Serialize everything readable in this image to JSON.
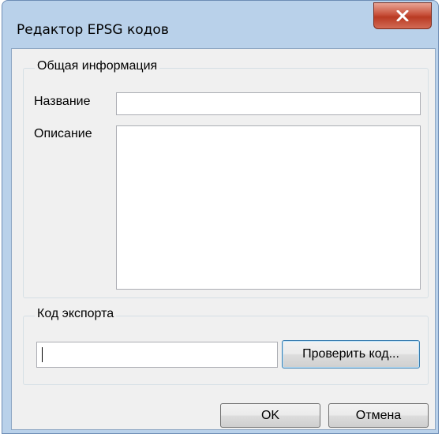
{
  "window": {
    "title": "Редактор EPSG кодов",
    "close_icon": "close-x-icon"
  },
  "general_group": {
    "legend": "Общая информация",
    "name_label": "Название",
    "name_value": "",
    "description_label": "Описание",
    "description_value": ""
  },
  "export_group": {
    "legend": "Код экспорта",
    "code_value": "",
    "check_button": "Проверить код..."
  },
  "footer": {
    "ok_button": "OK",
    "cancel_button": "Отмена"
  },
  "colors": {
    "frame": "#b9d1ea",
    "close_button": "#c8513b",
    "client": "#f0f0f0"
  }
}
